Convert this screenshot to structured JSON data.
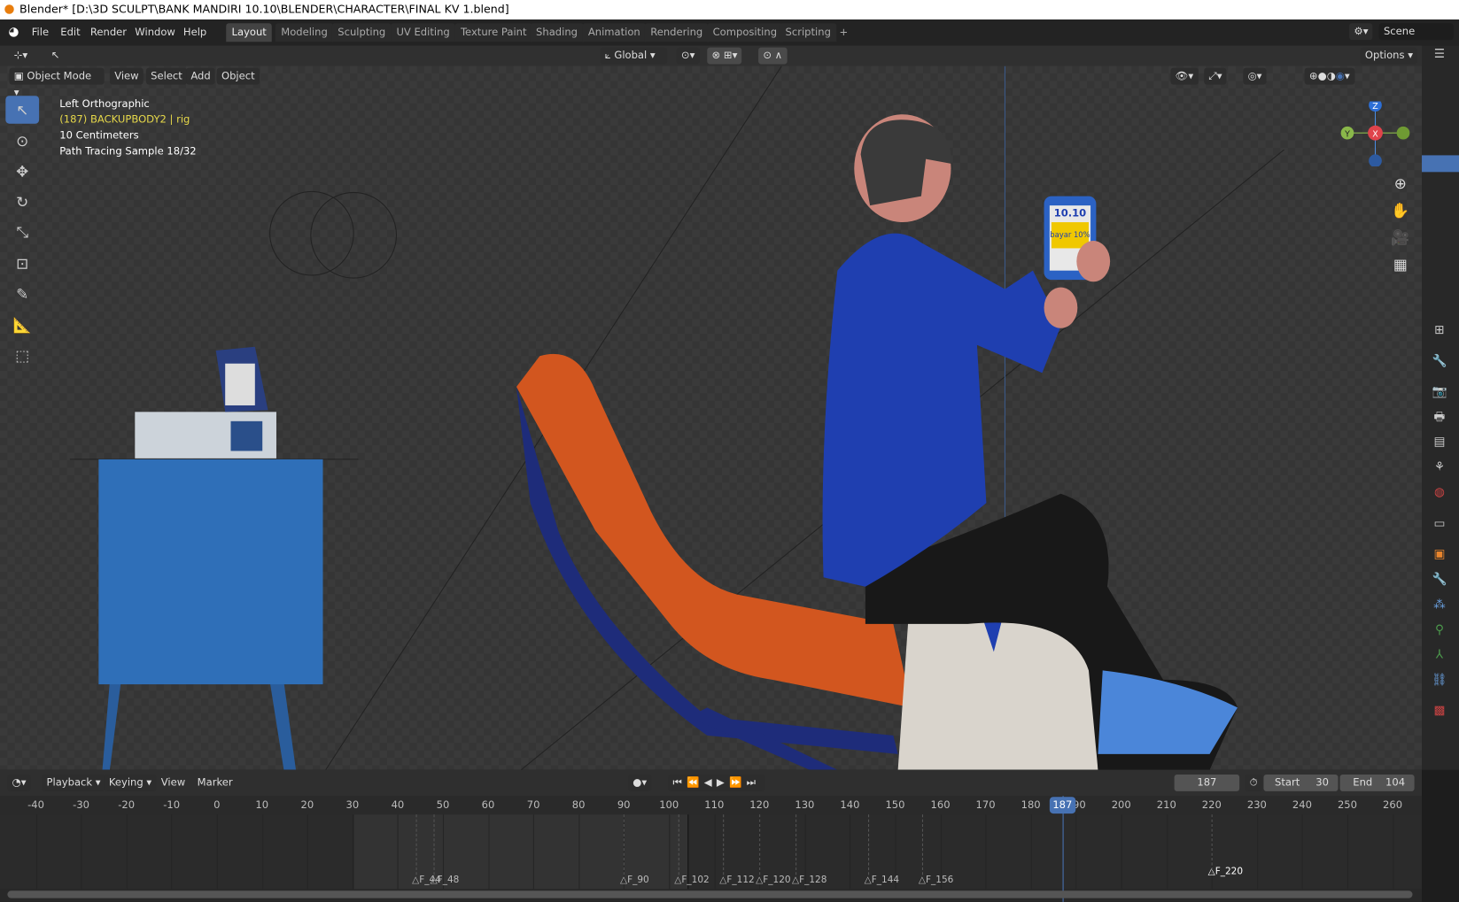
{
  "title": "Blender* [D:\\3D SCULPT\\BANK MANDIRI 10.10\\BLENDER\\CHARACTER\\FINAL KV 1.blend]",
  "menu": [
    "File",
    "Edit",
    "Render",
    "Window",
    "Help"
  ],
  "workspaces": [
    "Layout",
    "Modeling",
    "Sculpting",
    "UV Editing",
    "Texture Paint",
    "Shading",
    "Animation",
    "Rendering",
    "Compositing",
    "Scripting"
  ],
  "add_workspace": "+",
  "scene_label": "Scene",
  "tool_header": {
    "orientation": "Global",
    "options": "Options"
  },
  "viewport_header": {
    "mode": "Object Mode",
    "menus": [
      "View",
      "Select",
      "Add",
      "Object"
    ]
  },
  "overlay": {
    "view": "Left Orthographic",
    "object": "(187) BACKUPBODY2 | rig",
    "scale": "10 Centimeters",
    "render": "Path Tracing Sample 18/32"
  },
  "phone_screen": {
    "headline": "10.10",
    "promo": "bayar 10%"
  },
  "gizmo": {
    "z": "Z",
    "x": "X",
    "y": "Y"
  },
  "timeline": {
    "menus": [
      "Playback",
      "Keying",
      "View",
      "Marker"
    ],
    "current_frame": "187",
    "start_label": "Start",
    "start": "30",
    "end_label": "End",
    "end": "104",
    "ticks": [
      -40,
      -30,
      -20,
      -10,
      0,
      10,
      20,
      30,
      40,
      50,
      60,
      70,
      80,
      90,
      100,
      110,
      120,
      130,
      140,
      150,
      160,
      170,
      180,
      190,
      200,
      210,
      220,
      230,
      240,
      250,
      260
    ],
    "playhead": 187,
    "markers": [
      {
        "frame": 44,
        "label": "F_44"
      },
      {
        "frame": 48,
        "label": "F_48"
      },
      {
        "frame": 90,
        "label": "F_90"
      },
      {
        "frame": 102,
        "label": "F_102"
      },
      {
        "frame": 112,
        "label": "F_112"
      },
      {
        "frame": 120,
        "label": "F_120"
      },
      {
        "frame": 128,
        "label": "F_128"
      },
      {
        "frame": 144,
        "label": "F_144"
      },
      {
        "frame": 156,
        "label": "F_156"
      },
      {
        "frame": 220,
        "label": "F_220"
      }
    ]
  },
  "colors": {
    "accent": "#4772b3",
    "shirt": "#1f3fb0",
    "chair": "#d2561f",
    "cabinet": "#2f6fb8"
  }
}
